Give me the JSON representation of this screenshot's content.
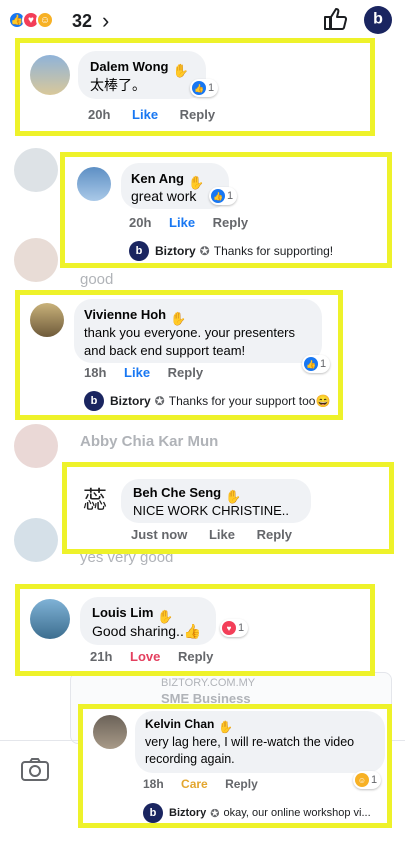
{
  "header": {
    "reaction_count": "32"
  },
  "background": {
    "good_text": "good",
    "abby_name": "Abby Chia Kar Mun",
    "yes_text": "yes very good",
    "link_domain": "BIZTORY.COM.MY",
    "link_title": "SME Business"
  },
  "comments": [
    {
      "name": "Dalem Wong",
      "text": "太棒了。",
      "time": "20h",
      "action": "Like",
      "reply": "Reply",
      "reaction_count": "1"
    },
    {
      "name": "Ken Ang",
      "text": "great work",
      "time": "20h",
      "action": "Like",
      "reply": "Reply",
      "reaction_count": "1",
      "page_reply": {
        "name": "Biztory",
        "text": "Thanks for supporting!"
      }
    },
    {
      "name": "Vivienne Hoh",
      "text_line1": "thank you everyone. your presenters",
      "text_line2": "and back end support team!",
      "time": "18h",
      "action": "Like",
      "reply": "Reply",
      "reaction_count": "1",
      "page_reply": {
        "name": "Biztory",
        "text": "Thanks for your support too😄"
      }
    },
    {
      "name": "Beh Che Seng",
      "text": "NICE WORK CHRISTINE..",
      "time": "Just now",
      "action": "Like",
      "reply": "Reply"
    },
    {
      "name": "Louis Lim",
      "text": "Good sharing..👍",
      "time": "21h",
      "action": "Love",
      "reply": "Reply",
      "reaction_count": "1"
    },
    {
      "name": "Kelvin Chan",
      "text_line1": "very lag here, I will re-watch the video",
      "text_line2": "recording again.",
      "time": "18h",
      "action": "Care",
      "reply": "Reply",
      "reaction_count": "1",
      "page_reply": {
        "name": "Biztory",
        "text": "okay, our online workshop vi..."
      }
    }
  ],
  "colors": {
    "highlight": "#eef22a",
    "like": "#1877f2",
    "love": "#e4405f",
    "care": "#e3a62f",
    "brand": "#1a2560"
  }
}
